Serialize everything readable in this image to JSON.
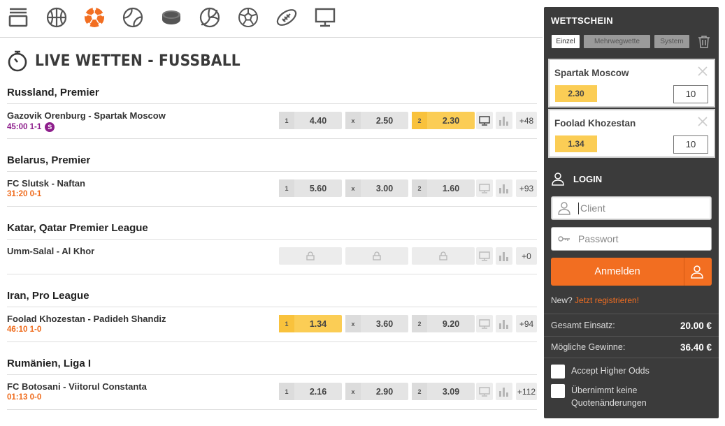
{
  "sports": [
    {
      "icon": "live-overview-icon"
    },
    {
      "icon": "basketball-icon"
    },
    {
      "icon": "soccer-ball-icon",
      "active": true
    },
    {
      "icon": "tennis-ball-icon"
    },
    {
      "icon": "ice-hockey-puck-icon"
    },
    {
      "icon": "volleyball-icon"
    },
    {
      "icon": "handball-icon"
    },
    {
      "icon": "american-football-icon"
    },
    {
      "icon": "tv-monitor-icon"
    }
  ],
  "page": {
    "title": "LIVE WETTEN - FUSSBALL"
  },
  "leagues": [
    {
      "name": "Russland, Premier",
      "match": {
        "teams": "Gazovik Orenburg - Spartak Moscow",
        "score": "45:00 1-1",
        "score_color": "#8e1f8c",
        "badge": "S",
        "odds": [
          {
            "label": "1",
            "value": "4.40"
          },
          {
            "label": "x",
            "value": "2.50"
          },
          {
            "label": "2",
            "value": "2.30",
            "selected": true
          }
        ],
        "more": "+48"
      }
    },
    {
      "name": "Belarus, Premier",
      "match": {
        "teams": "FC Slutsk - Naftan",
        "score": "31:20 0-1",
        "score_color": "#ef6b1c",
        "odds": [
          {
            "label": "1",
            "value": "5.60"
          },
          {
            "label": "x",
            "value": "3.00"
          },
          {
            "label": "2",
            "value": "1.60"
          }
        ],
        "more": "+93"
      }
    },
    {
      "name": "Katar, Qatar Premier League",
      "match": {
        "teams": "Umm-Salal - Al Khor",
        "score": "",
        "locked": true,
        "more": "+0"
      }
    },
    {
      "name": "Iran, Pro League",
      "match": {
        "teams": "Foolad Khozestan - Padideh Shandiz",
        "score": "46:10 1-0",
        "score_color": "#ef6b1c",
        "odds": [
          {
            "label": "1",
            "value": "1.34",
            "selected": true
          },
          {
            "label": "x",
            "value": "3.60"
          },
          {
            "label": "2",
            "value": "9.20"
          }
        ],
        "more": "+94"
      }
    },
    {
      "name": "Rumänien, Liga I",
      "match": {
        "teams": "FC Botosani - Viitorul Constanta",
        "score": "01:13 0-0",
        "score_color": "#ef6b1c",
        "odds": [
          {
            "label": "1",
            "value": "2.16"
          },
          {
            "label": "x",
            "value": "2.90"
          },
          {
            "label": "2",
            "value": "3.09"
          }
        ],
        "more": "+112"
      }
    }
  ],
  "betslip": {
    "title": "WETTSCHEIN",
    "tabs": [
      {
        "label": "Einzel",
        "active": true
      },
      {
        "label": "Mehrwegwette"
      },
      {
        "label": "System"
      }
    ],
    "bets": [
      {
        "name": "Spartak Moscow",
        "odd": "2.30",
        "stake": "10"
      },
      {
        "name": "Foolad Khozestan",
        "odd": "1.34",
        "stake": "10"
      }
    ],
    "login": {
      "title": "LOGIN",
      "client_placeholder": "Client",
      "password_placeholder": "Passwort",
      "button": "Anmelden",
      "new_text": "New?",
      "register_link": "Jetzt registrieren!"
    },
    "summary": {
      "total_label": "Gesamt Einsatz:",
      "total_value": "20.00 €",
      "win_label": "Mögliche Gewinne:",
      "win_value": "36.40 €"
    },
    "options": [
      {
        "label": "Accept Higher Odds"
      },
      {
        "label": "Übernimmt keine Quotenänderungen"
      }
    ]
  },
  "colors": {
    "accent": "#f26e21",
    "selected_odd": "#fbcd55",
    "live_purple": "#8e1f8c",
    "live_orange": "#ef6b1c",
    "panel_bg": "#3b3b3b"
  }
}
